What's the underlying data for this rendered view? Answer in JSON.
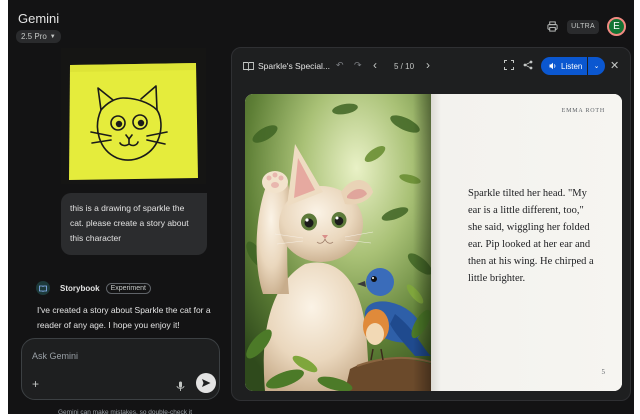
{
  "header": {
    "app_title": "Gemini",
    "model_label": "2.5 Pro",
    "plan_badge": "ULTRA",
    "avatar_letter": "E"
  },
  "chat": {
    "user_message": "this is a drawing of sparkle the cat. please create a story about this character",
    "storybook_label": "Storybook",
    "experiment_tag": "Experiment",
    "reply_text": "I've created a story about Sparkle the cat for a reader of any age. I hope you enjoy it!",
    "input_placeholder": "Ask Gemini",
    "disclaimer": "Gemini can make mistakes, so double-check it"
  },
  "storybook": {
    "title": "Sparkle's Special...",
    "page_indicator": "5 / 10",
    "listen_label": "Listen",
    "author": "EMMA ROTH",
    "page_text": "Sparkle tilted her head. \"My ear is a little different, too,\" she said, wiggling her folded ear. Pip looked at her ear and then at his wing. He chirped a little brighter.",
    "page_number": "5"
  },
  "colors": {
    "background": "#131314",
    "accent": "#0b57d0",
    "sticky_note": "#e5ec3c",
    "avatar": "#137333"
  },
  "icons": [
    "printer-icon",
    "book-icon",
    "undo-icon",
    "redo-icon",
    "chevron-left-icon",
    "chevron-right-icon",
    "fullscreen-icon",
    "share-icon",
    "speaker-icon",
    "close-icon",
    "plus-icon",
    "mic-icon",
    "send-icon"
  ]
}
